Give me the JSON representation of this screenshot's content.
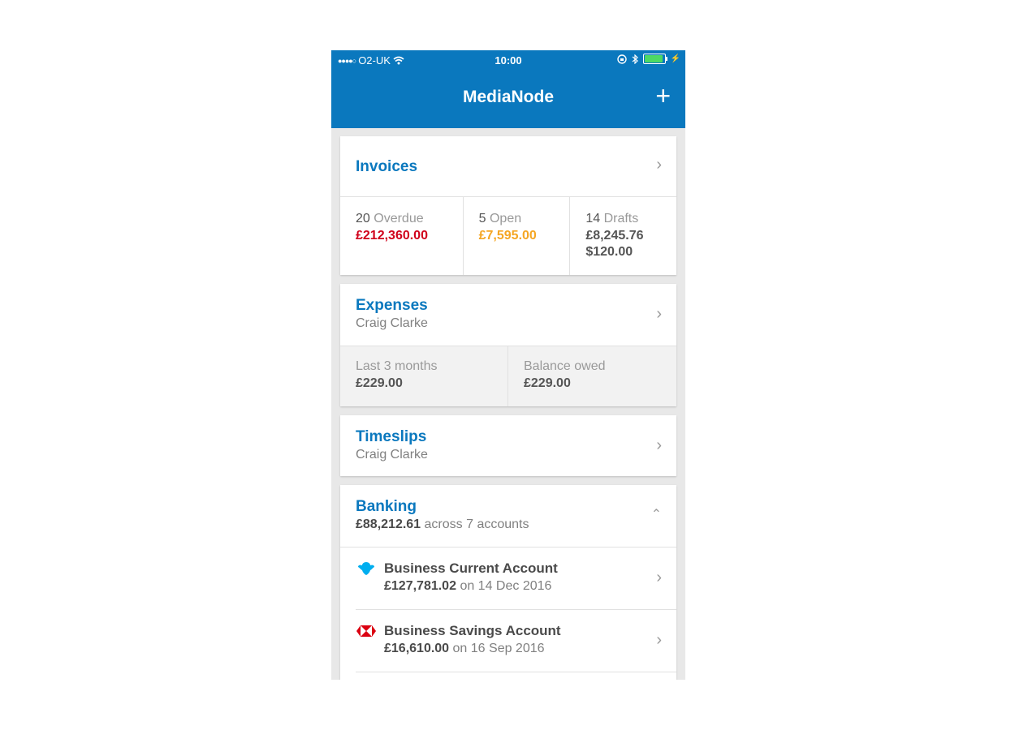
{
  "status": {
    "carrier": "O2-UK",
    "time": "10:00"
  },
  "appbar": {
    "title": "MediaNode",
    "add_label": "+"
  },
  "invoices": {
    "title": "Invoices",
    "overdue_count": "20",
    "overdue_label": "Overdue",
    "overdue_amount": "£212,360.00",
    "open_count": "5",
    "open_label": "Open",
    "open_amount": "£7,595.00",
    "drafts_count": "14",
    "drafts_label": "Drafts",
    "drafts_amount_gbp": "£8,245.76",
    "drafts_amount_usd": "$120.00"
  },
  "expenses": {
    "title": "Expenses",
    "person": "Craig Clarke",
    "last3_label": "Last 3 months",
    "last3_amount": "£229.00",
    "owed_label": "Balance owed",
    "owed_amount": "£229.00"
  },
  "timeslips": {
    "title": "Timeslips",
    "person": "Craig Clarke"
  },
  "banking": {
    "title": "Banking",
    "total": "£88,212.61",
    "across": "across 7 accounts",
    "accounts": [
      {
        "name": "Business Current Account",
        "balance": "£127,781.02",
        "date": "on 14 Dec 2016",
        "logo": "barclays-eagle-icon"
      },
      {
        "name": "Business Savings Account",
        "balance": "£16,610.00",
        "date": "on 16 Sep 2016",
        "logo": "hsbc-hexagon-icon"
      }
    ]
  },
  "colors": {
    "brand": "#0a78be",
    "overdue": "#d0021b",
    "open": "#f5a623",
    "battery": "#4cd964"
  }
}
